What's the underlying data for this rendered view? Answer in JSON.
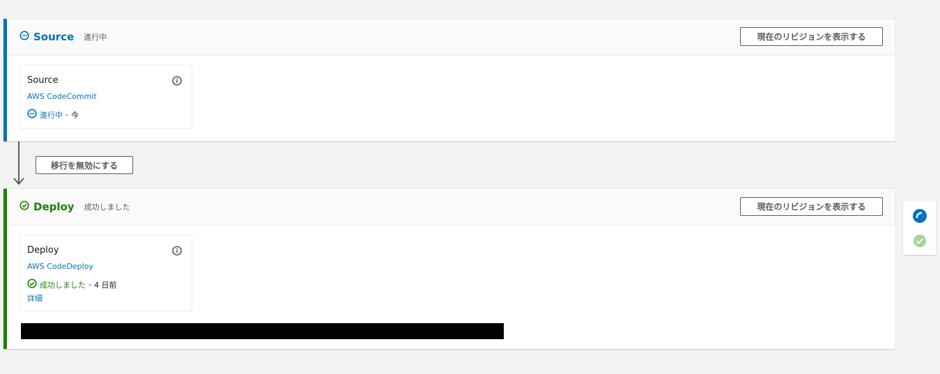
{
  "colors": {
    "info": "#0073bb",
    "success": "#1d8102",
    "button_border": "#545b64",
    "background": "#f2f3f3"
  },
  "stages": [
    {
      "title": "Source",
      "status": "進行中",
      "status_icon": "in-progress-icon",
      "view_revision_label": "現在のリビジョンを表示する",
      "action": {
        "name": "Source",
        "provider": "AWS CodeCommit",
        "status": "進行中",
        "separator": "-",
        "time": "今"
      }
    },
    {
      "title": "Deploy",
      "status": "成功しました",
      "status_icon": "success-check-icon",
      "view_revision_label": "現在のリビジョンを表示する",
      "action": {
        "name": "Deploy",
        "provider": "AWS CodeDeploy",
        "status": "成功しました",
        "separator": "-",
        "time": "4 日前",
        "details": "詳細"
      }
    }
  ],
  "transition": {
    "disable_label": "移行を無効にする"
  },
  "side_panel": {
    "icons": [
      "in-progress-icon",
      "success-check-icon"
    ]
  }
}
